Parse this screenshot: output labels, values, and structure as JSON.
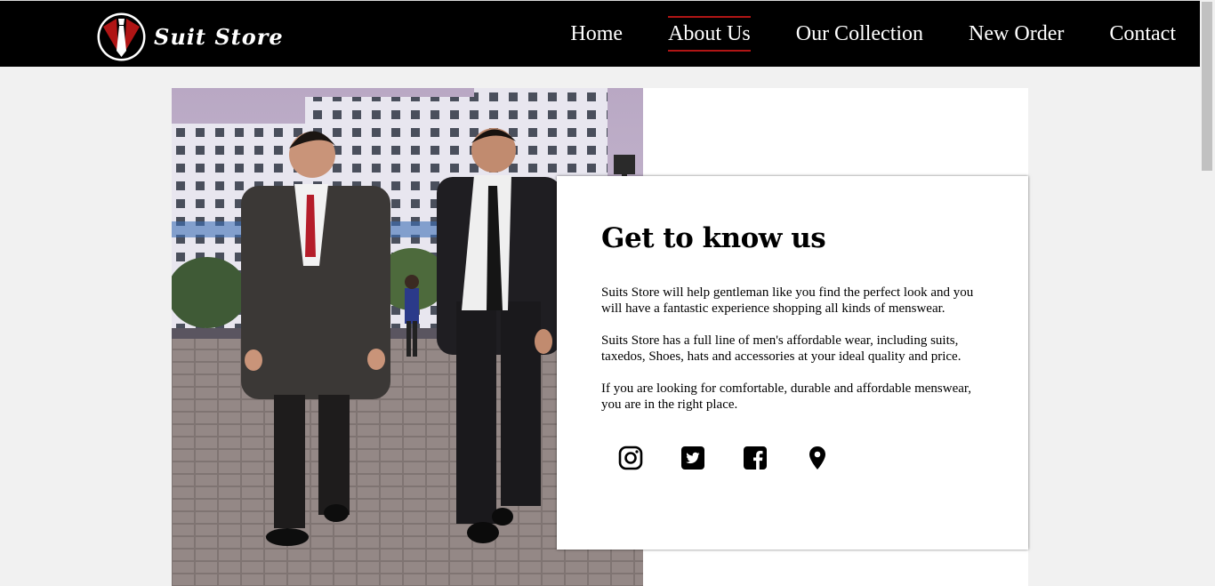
{
  "brand": {
    "name": "Suit Store",
    "accent_color": "#b01515"
  },
  "nav": {
    "items": [
      {
        "label": "Home",
        "active": false
      },
      {
        "label": "About Us",
        "active": true
      },
      {
        "label": "Our Collection",
        "active": false
      },
      {
        "label": "New Order",
        "active": false
      },
      {
        "label": "Contact",
        "active": false
      }
    ]
  },
  "about": {
    "title": "Get to know us",
    "paragraphs": [
      "Suits Store will help gentleman like you find the perfect look and you will have a fantastic experience shopping all kinds of menswear.",
      "Suits Store has a full line of men's affordable wear, including suits, taxedos, Shoes, hats and accessories at your ideal quality and price.",
      "If you are looking for comfortable, durable and affordable menswear, you are in the right place."
    ],
    "socials": [
      {
        "name": "instagram-icon"
      },
      {
        "name": "twitter-icon"
      },
      {
        "name": "facebook-icon"
      },
      {
        "name": "location-pin-icon"
      }
    ]
  },
  "hero_image": {
    "subject": "two-men-in-suits-photo"
  }
}
